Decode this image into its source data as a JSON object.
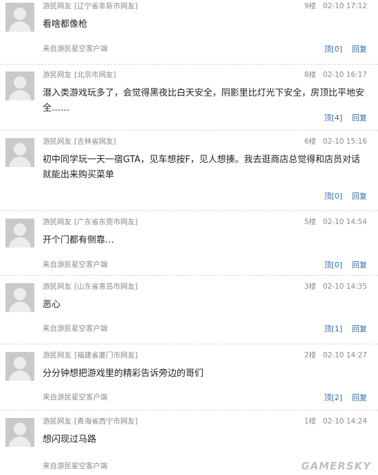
{
  "comments": [
    {
      "user": "游民网友",
      "location": "[辽宁省阜新市网友]",
      "floor": "9楼",
      "time": "02-10 17:12",
      "text": "看啥都像枪",
      "source": "来自游民星空客户端",
      "like_label": "顶[0]",
      "reply_label": "回复"
    },
    {
      "user": "游民网友",
      "location": "[北京市网友]",
      "floor": "8楼",
      "time": "02-10 16:17",
      "text": "潜入类游戏玩多了，会觉得黑夜比白天安全，阴影里比灯光下安全，房顶比平地安全……",
      "source": "",
      "like_label": "顶[4]",
      "reply_label": "回复"
    },
    {
      "user": "游民网友",
      "location": "[吉林省网友]",
      "floor": "6楼",
      "time": "02-10 15:16",
      "text": "初中同学玩一天一宿GTA，见车想按F，见人想揍。我去逛商店总觉得和店员对话就能出来购买菜单",
      "source": "",
      "like_label": "顶[0]",
      "reply_label": "回复"
    },
    {
      "user": "游民网友",
      "location": "[广东省东莞市网友]",
      "floor": "5楼",
      "time": "02-10 14:54",
      "text": "开个门都有侧靠…",
      "source": "来自游民星空客户端",
      "like_label": "顶[0]",
      "reply_label": "回复"
    },
    {
      "user": "游民网友",
      "location": "[山东省青岛市网友]",
      "floor": "3楼",
      "time": "02-10 14:35",
      "text": "恶心",
      "source": "来自游民星空客户端",
      "like_label": "顶[1]",
      "reply_label": "回复"
    },
    {
      "user": "游民网友",
      "location": "[福建省厦门市网友]",
      "floor": "2楼",
      "time": "02-10 14:27",
      "text": "分分钟想把游戏里的精彩告诉旁边的哥们",
      "source": "来自游民星空客户端",
      "like_label": "顶[2]",
      "reply_label": "回复"
    },
    {
      "user": "游民网友",
      "location": "[青海省西宁市网友]",
      "floor": "1楼",
      "time": "02-10 14:24",
      "text": "想闪现过马路",
      "source": "来自游民星空客户端",
      "like_label": "",
      "reply_label": ""
    }
  ],
  "watermark": "GAMERSKY",
  "colors": {
    "link": "#2c6aa8",
    "meta_text": "#8a8a8a",
    "body_text": "#222222",
    "avatar_bg": "#c9c9c9"
  },
  "icons": {
    "avatar": "default-user-avatar-icon"
  }
}
